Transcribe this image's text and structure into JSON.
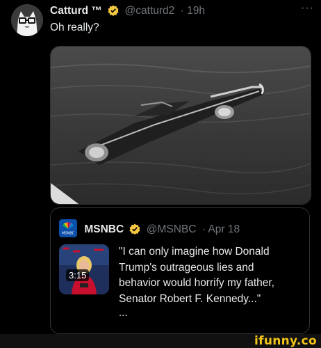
{
  "tweet": {
    "author_name": "Catturd ™",
    "author_handle": "@catturd2",
    "time": "· 19h",
    "more_label": "···",
    "text": "Oh really?"
  },
  "quoted_tweet": {
    "author_name": "MSNBC",
    "author_handle": "@MSNBC",
    "date": "· Apr 18",
    "video_duration": "3:15",
    "text": "\"I can only imagine how Donald Trump's outrageous lies and behavior would horrify my father, Senator Robert F. Kennedy...\"",
    "ellipsis": "..."
  },
  "watermark": "ifunny.co",
  "colors": {
    "verified_badge": "#f5c842",
    "msnbc_blue": "#0b4fa8",
    "watermark": "#f2c318"
  }
}
